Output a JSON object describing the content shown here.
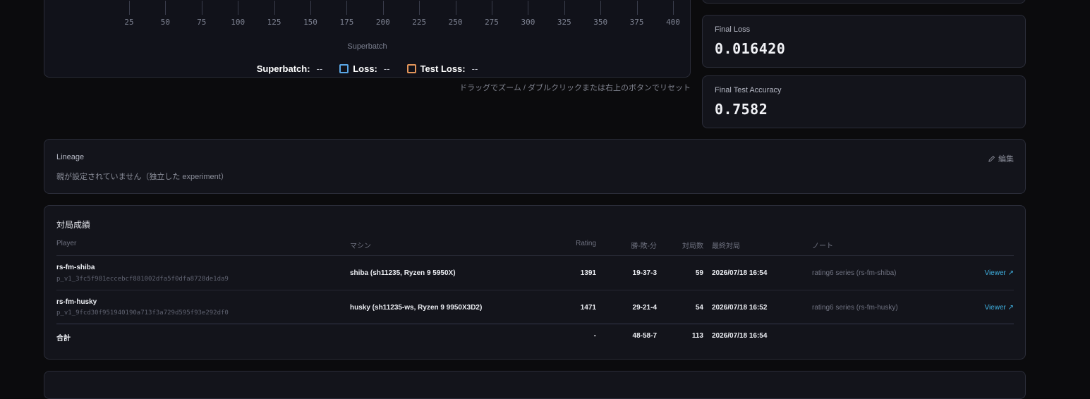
{
  "chart": {
    "ticks": [
      "25",
      "50",
      "75",
      "100",
      "125",
      "150",
      "175",
      "200",
      "225",
      "250",
      "275",
      "300",
      "325",
      "350",
      "375",
      "400"
    ],
    "x_axis_title": "Superbatch",
    "legend": {
      "superbatch_label": "Superbatch:",
      "superbatch_value": "--",
      "loss_label": "Loss:",
      "loss_value": "--",
      "test_loss_label": "Test Loss:",
      "test_loss_value": "--"
    },
    "colors": {
      "loss": "#5aa7e6",
      "test_loss": "#e3955a"
    },
    "hint": "ドラッグでズーム / ダブルクリックまたは右上のボタンでリセット"
  },
  "stats": {
    "final_loss_label": "Final Loss",
    "final_loss_value": "0.016420",
    "final_test_accuracy_label": "Final Test Accuracy",
    "final_test_accuracy_value": "0.7582"
  },
  "lineage": {
    "title": "Lineage",
    "description": "親が設定されていません（独立した experiment）",
    "edit_label": "編集"
  },
  "results": {
    "title": "対局成績",
    "headers": {
      "player": "Player",
      "machine": "マシン",
      "rating": "Rating",
      "wld": "勝-敗-分",
      "games": "対局数",
      "last_game": "最終対局",
      "note": "ノート"
    },
    "rows": [
      {
        "player": "rs-fm-shiba",
        "hash": "p_v1_3fc5f981eccebcf881002dfa5f0dfa8728de1da9",
        "machine": "shiba (sh11235, Ryzen 9 5950X)",
        "rating": "1391",
        "wld": "19-37-3",
        "games": "59",
        "last_game": "2026/07/18 16:54",
        "note": "rating6 series (rs-fm-shiba)",
        "viewer": "Viewer ↗"
      },
      {
        "player": "rs-fm-husky",
        "hash": "p_v1_9fcd30f951940190a713f3a729d595f93e292df0",
        "machine": "husky (sh11235-ws, Ryzen 9 9950X3D2)",
        "rating": "1471",
        "wld": "29-21-4",
        "games": "54",
        "last_game": "2026/07/18 16:52",
        "note": "rating6 series (rs-fm-husky)",
        "viewer": "Viewer ↗"
      }
    ],
    "total": {
      "label": "合計",
      "rating": "-",
      "wld": "48-58-7",
      "games": "113",
      "last_game": "2026/07/18 16:54"
    }
  }
}
